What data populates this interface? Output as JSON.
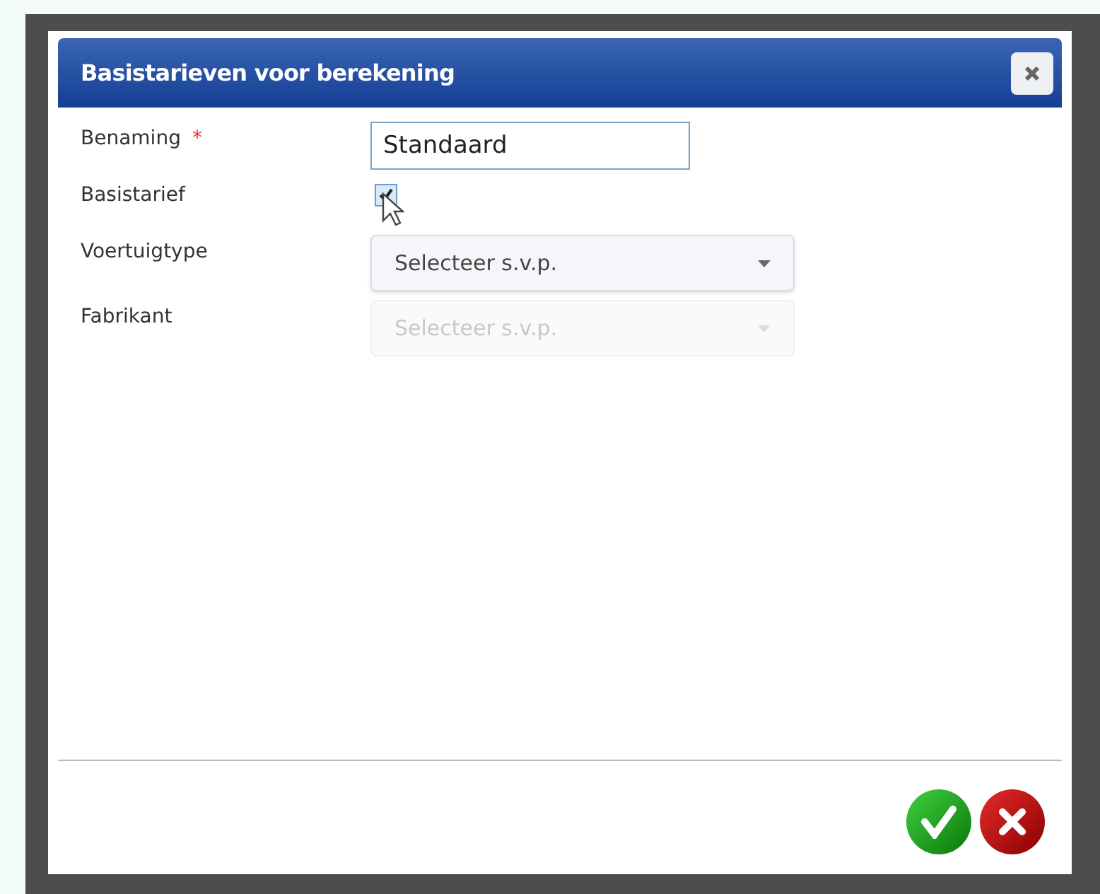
{
  "dialog": {
    "title": "Basistarieven voor berekening"
  },
  "fields": [
    {
      "kind": "text",
      "label": "Benaming",
      "required": true,
      "value": "Standaard"
    },
    {
      "kind": "checkbox",
      "label": "Basistarief",
      "required": false,
      "checked": true
    },
    {
      "kind": "select",
      "label": "Voertuigtype",
      "required": false,
      "placeholder": "Selecteer s.v.p.",
      "disabled": false
    },
    {
      "kind": "select",
      "label": "Fabrikant",
      "required": false,
      "placeholder": "Selecteer s.v.p.",
      "disabled": true
    }
  ],
  "required_mark": "*"
}
